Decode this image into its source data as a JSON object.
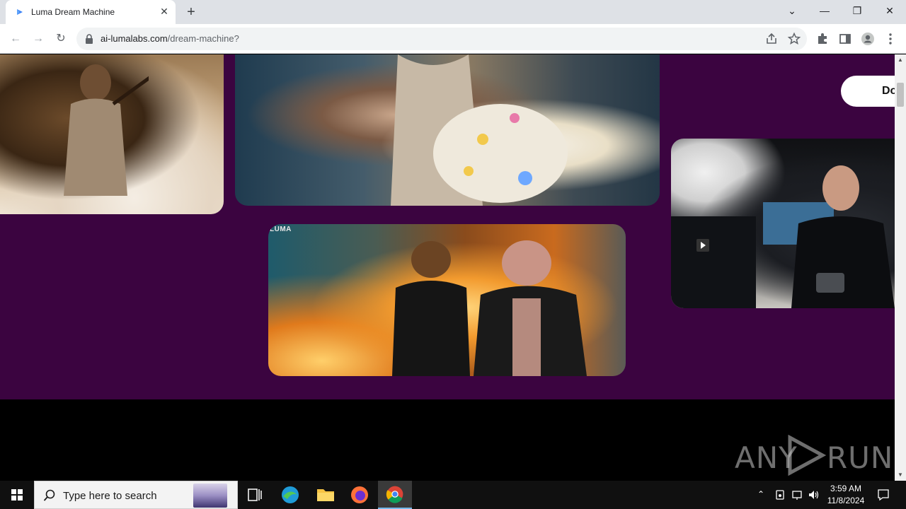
{
  "browser": {
    "tab": {
      "title": "Luma Dream Machine",
      "close_glyph": "✕"
    },
    "new_tab_glyph": "+",
    "window_controls": {
      "tab_search": "⌄",
      "minimize": "—",
      "restore": "❐",
      "close": "✕"
    },
    "address": {
      "host": "ai-lumalabs.com",
      "path": "/dream-machine?"
    },
    "nav": {
      "back": "←",
      "forward": "→",
      "reload": "↻"
    }
  },
  "page": {
    "download_button": "Down",
    "video_tag": "LUMA",
    "images": [
      {
        "name": "old-man-banjo-image"
      },
      {
        "name": "woman-flowers-image"
      },
      {
        "name": "bear-pig-explosion-image"
      },
      {
        "name": "man-camera-studio-image"
      }
    ]
  },
  "watermark": {
    "text_left": "ANY",
    "text_right": "RUN"
  },
  "taskbar": {
    "search_placeholder": "Type here to search",
    "clock": {
      "time": "3:59 AM",
      "date": "11/8/2024"
    }
  },
  "colors": {
    "page_purple": "#3b0440",
    "chrome_tabstrip": "#dee1e6",
    "taskbar": "#101010"
  }
}
